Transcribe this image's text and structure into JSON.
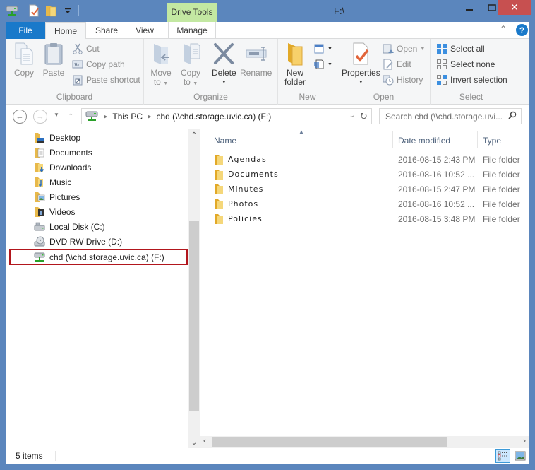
{
  "window": {
    "title": "F:\\",
    "context_tab_group": "Drive Tools",
    "controls": {
      "minimize": "—",
      "maximize": "☐",
      "close": "✕"
    }
  },
  "ribbon_tabs": [
    {
      "label": "File"
    },
    {
      "label": "Home",
      "active": true
    },
    {
      "label": "Share"
    },
    {
      "label": "View"
    },
    {
      "label": "Manage"
    }
  ],
  "ribbon": {
    "clipboard": {
      "label": "Clipboard",
      "copy": "Copy",
      "paste": "Paste",
      "cut": "Cut",
      "copy_path": "Copy path",
      "paste_shortcut": "Paste shortcut"
    },
    "organize": {
      "label": "Organize",
      "move_to": [
        "Move",
        "to"
      ],
      "copy_to": [
        "Copy",
        "to"
      ],
      "delete": "Delete",
      "rename": "Rename"
    },
    "new": {
      "label": "New",
      "new_folder": [
        "New",
        "folder"
      ]
    },
    "open": {
      "label": "Open",
      "properties": "Properties",
      "open": "Open",
      "edit": "Edit",
      "history": "History"
    },
    "select": {
      "label": "Select",
      "select_all": "Select all",
      "select_none": "Select none",
      "invert_selection": "Invert selection"
    }
  },
  "address_bar": {
    "crumbs": [
      "This PC",
      "chd (\\\\chd.storage.uvic.ca) (F:)"
    ],
    "search_placeholder": "Search chd (\\\\chd.storage.uvi..."
  },
  "nav_pane": {
    "items": [
      {
        "label": "Desktop",
        "icon": "desktop-folder-icon"
      },
      {
        "label": "Documents",
        "icon": "documents-folder-icon"
      },
      {
        "label": "Downloads",
        "icon": "downloads-folder-icon"
      },
      {
        "label": "Music",
        "icon": "music-folder-icon"
      },
      {
        "label": "Pictures",
        "icon": "pictures-folder-icon"
      },
      {
        "label": "Videos",
        "icon": "videos-folder-icon"
      },
      {
        "label": "Local Disk (C:)",
        "icon": "local-disk-icon"
      },
      {
        "label": "DVD RW Drive (D:)",
        "icon": "dvd-drive-icon"
      },
      {
        "label": "chd (\\\\chd.storage.uvic.ca) (F:)",
        "icon": "network-drive-icon",
        "selected": true
      }
    ]
  },
  "file_list": {
    "columns": [
      "Name",
      "Date modified",
      "Type"
    ],
    "rows": [
      {
        "name": "Agendas",
        "date": "2016-08-15 2:43 PM",
        "type": "File folder"
      },
      {
        "name": "Documents",
        "date": "2016-08-16 10:52 ...",
        "type": "File folder"
      },
      {
        "name": "Minutes",
        "date": "2016-08-15 2:47 PM",
        "type": "File folder"
      },
      {
        "name": "Photos",
        "date": "2016-08-16 10:52 ...",
        "type": "File folder"
      },
      {
        "name": "Policies",
        "date": "2016-08-15 3:48 PM",
        "type": "File folder"
      }
    ]
  },
  "status_bar": {
    "item_count": "5 items"
  },
  "colors": {
    "frame": "#5b86bd",
    "file_tab": "#1979ca",
    "context_tab": "#c3e8a2",
    "close_button": "#c75050",
    "selection_outline": "#b2161d"
  }
}
